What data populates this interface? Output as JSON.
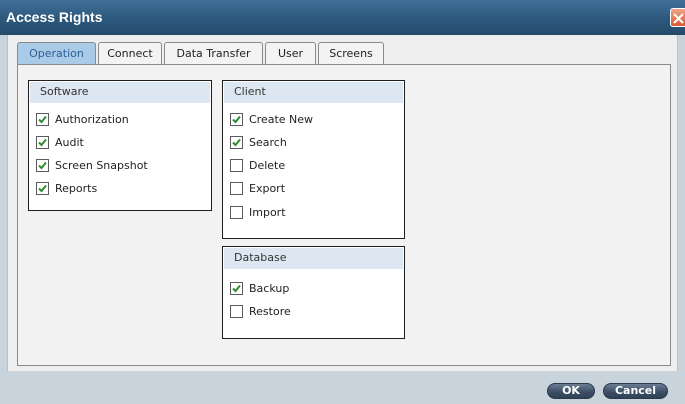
{
  "window": {
    "title": "Access Rights"
  },
  "tabs": [
    {
      "label": "Operation",
      "active": true
    },
    {
      "label": "Connect",
      "active": false
    },
    {
      "label": "Data Transfer",
      "active": false
    },
    {
      "label": "User",
      "active": false
    },
    {
      "label": "Screens",
      "active": false
    }
  ],
  "groups": {
    "software": {
      "title": "Software",
      "items": [
        {
          "label": "Authorization",
          "checked": true
        },
        {
          "label": "Audit",
          "checked": true
        },
        {
          "label": "Screen Snapshot",
          "checked": true
        },
        {
          "label": "Reports",
          "checked": true
        }
      ]
    },
    "client": {
      "title": "Client",
      "items": [
        {
          "label": "Create New",
          "checked": true
        },
        {
          "label": "Search",
          "checked": true
        },
        {
          "label": "Delete",
          "checked": false
        },
        {
          "label": "Export",
          "checked": false
        },
        {
          "label": "Import",
          "checked": false
        }
      ]
    },
    "database": {
      "title": "Database",
      "items": [
        {
          "label": "Backup",
          "checked": true
        },
        {
          "label": "Restore",
          "checked": false
        }
      ]
    }
  },
  "buttons": {
    "ok_label": "OK",
    "cancel_label": "Cancel"
  },
  "colors": {
    "title_bar": "#2d587d",
    "active_tab": "#a9cbe7",
    "check_mark": "#2e8b2e",
    "group_header": "#dde7f1"
  }
}
